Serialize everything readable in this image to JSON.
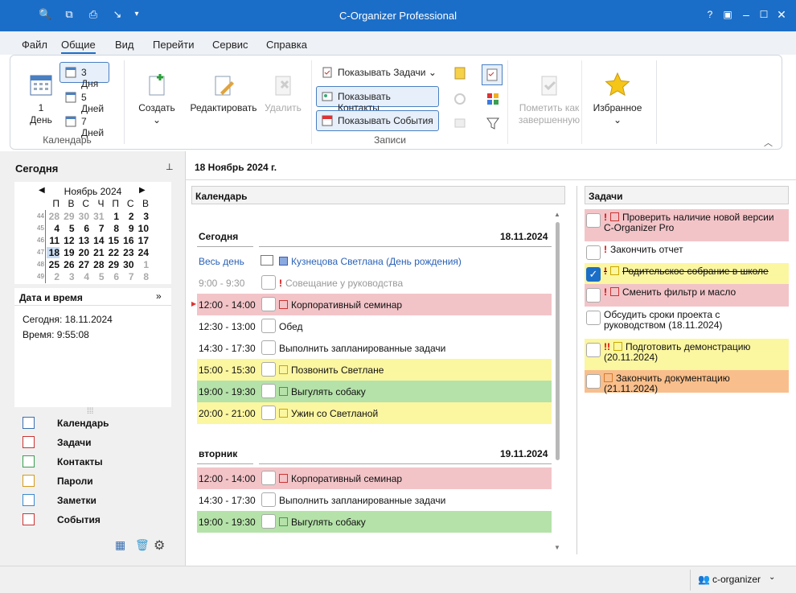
{
  "window": {
    "title": "C-Organizer Professional"
  },
  "menu": [
    "Файл",
    "Общие",
    "Вид",
    "Перейти",
    "Сервис",
    "Справка"
  ],
  "ribbon": {
    "cal": {
      "one_day": "1",
      "one_day2": "День",
      "three": "3 Дня",
      "five": "5 Дней",
      "seven": "7 Дней",
      "group": "Календарь"
    },
    "rec": {
      "create": "Создать",
      "edit": "Редактировать",
      "delete": "Удалить",
      "show_tasks": "Показывать Задачи",
      "show_contacts": "Показывать Контакты",
      "show_events": "Показывать События",
      "mark1": "Пометить как",
      "mark2": "завершенную",
      "fav": "Избранное",
      "group": "Записи"
    }
  },
  "left": {
    "today_title": "Сегодня",
    "month": "Ноябрь 2024",
    "weekdays": [
      "П",
      "В",
      "С",
      "Ч",
      "П",
      "С",
      "В"
    ],
    "weeks": [
      {
        "n": "44",
        "d": [
          "28",
          "29",
          "30",
          "31",
          "1",
          "2",
          "3"
        ]
      },
      {
        "n": "45",
        "d": [
          "4",
          "5",
          "6",
          "7",
          "8",
          "9",
          "10"
        ]
      },
      {
        "n": "46",
        "d": [
          "11",
          "12",
          "13",
          "14",
          "15",
          "16",
          "17"
        ]
      },
      {
        "n": "47",
        "d": [
          "18",
          "19",
          "20",
          "21",
          "22",
          "23",
          "24"
        ]
      },
      {
        "n": "48",
        "d": [
          "25",
          "26",
          "27",
          "28",
          "29",
          "30",
          "1"
        ]
      },
      {
        "n": "49",
        "d": [
          "2",
          "3",
          "4",
          "5",
          "6",
          "7",
          "8"
        ]
      }
    ],
    "dt_title": "Дата и время",
    "today_line": "Сегодня: 18.11.2024",
    "time_line": "Время: 9:55:08",
    "nav": [
      "Календарь",
      "Задачи",
      "Контакты",
      "Пароли",
      "Заметки",
      "События"
    ]
  },
  "main": {
    "date_header": "18 Ноябрь 2024 г.",
    "cal_title": "Календарь",
    "tasks_title": "Задачи",
    "day1": {
      "name": "Сегодня",
      "date": "18.11.2024"
    },
    "day2": {
      "name": "вторник",
      "date": "19.11.2024"
    },
    "allday": {
      "label": "Весь день",
      "text": "Кузнецова Светлана (День рождения)"
    },
    "events1": [
      {
        "t": "9:00 - 9:30",
        "x": "Совещание у руководства"
      },
      {
        "t": "12:00 - 14:00",
        "x": "Корпоративный семинар"
      },
      {
        "t": "12:30 - 13:00",
        "x": "Обед"
      },
      {
        "t": "14:30 - 17:30",
        "x": "Выполнить запланированные задачи"
      },
      {
        "t": "15:00 - 15:30",
        "x": "Позвонить Светлане"
      },
      {
        "t": "19:00 - 19:30",
        "x": "Выгулять собаку"
      },
      {
        "t": "20:00 - 21:00",
        "x": "Ужин со Светланой"
      }
    ],
    "events2": [
      {
        "t": "12:00 - 14:00",
        "x": "Корпоративный семинар"
      },
      {
        "t": "14:30 - 17:30",
        "x": "Выполнить запланированные задачи"
      },
      {
        "t": "19:00 - 19:30",
        "x": "Выгулять собаку"
      }
    ],
    "tasks": [
      "Проверить наличие новой версии C-Organizer Pro",
      "Закончить отчет",
      "Родительское собрание в школе",
      "Сменить фильтр и масло",
      "Обсудить сроки проекта с руководством (18.11.2024)",
      "Подготовить демонстрацию (20.11.2024)",
      "Закончить документацию (21.11.2024)"
    ],
    "colors": {
      "red": "#f2c4c8",
      "yellow": "#fbf6a0",
      "green": "#b5e2a9",
      "orange": "#f8bf8c",
      "blue": "#e9f2fc"
    }
  },
  "status": {
    "user": "c-organizer"
  }
}
